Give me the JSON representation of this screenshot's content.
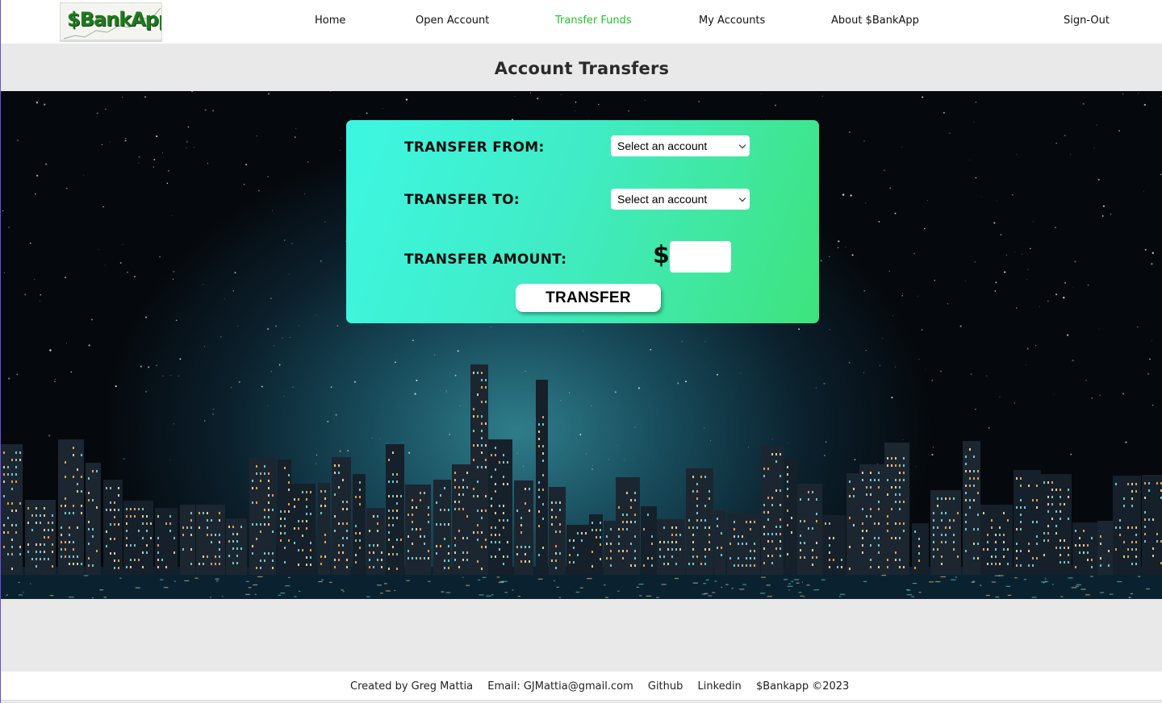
{
  "nav": {
    "logo_text": "$BankApp",
    "links": [
      {
        "label": "Home"
      },
      {
        "label": "Open Account"
      },
      {
        "label": "Transfer Funds",
        "active": true
      },
      {
        "label": "My Accounts"
      },
      {
        "label": "About $BankApp"
      }
    ],
    "signout": "Sign-Out"
  },
  "heading": "Account Transfers",
  "form": {
    "from_label": "TRANSFER FROM:",
    "from_select": "Select an account",
    "to_label": "TRANSFER TO:",
    "to_select": "Select an account",
    "amount_label": "TRANSFER AMOUNT:",
    "currency_symbol": "$",
    "amount_value": "",
    "submit": "TRANSFER"
  },
  "footer": {
    "created_by": "Created by Greg Mattia",
    "email": "Email: GJMattia@gmail.com",
    "github": "Github",
    "linkedin": "Linkedin",
    "copyright": "$Bankapp ©2023"
  },
  "colors": {
    "active_nav": "#22c32a",
    "card_gradient_start": "#3df7e2",
    "card_gradient_end": "#3fe37d",
    "page_bg": "#e9e9e9"
  }
}
